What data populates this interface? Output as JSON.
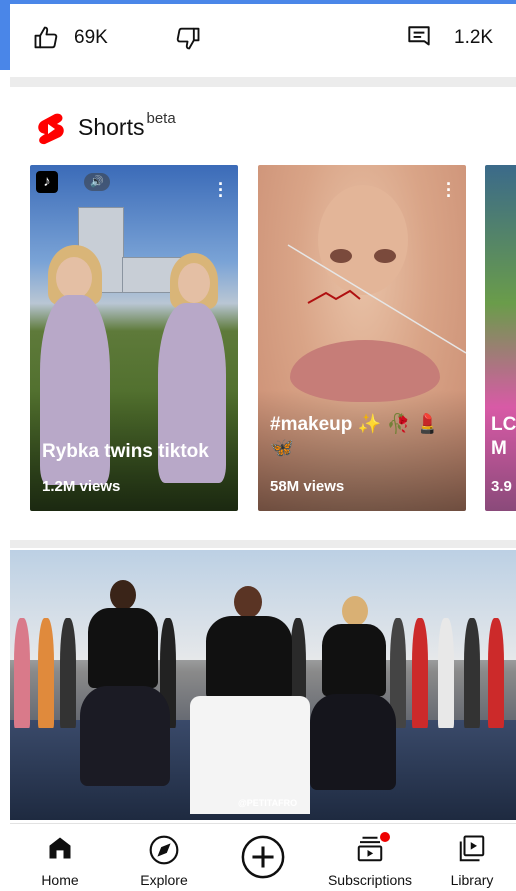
{
  "actions": {
    "like_count": "69K",
    "comment_count": "1.2K"
  },
  "shorts": {
    "title": "Shorts",
    "badge": "beta",
    "items": [
      {
        "title": "Rybka twins tiktok",
        "views": "1.2M views"
      },
      {
        "title": "#makeup ✨ 🥀 💄 🦋",
        "views": "58M views"
      },
      {
        "title": "LC M",
        "views": "3.9"
      }
    ]
  },
  "video": {
    "watermark": "@PETITAFRO"
  },
  "nav": {
    "home": "Home",
    "explore": "Explore",
    "subscriptions": "Subscriptions",
    "library": "Library"
  },
  "colors": {
    "accent_blue": "#4a86e8",
    "shorts_red": "#ff0000",
    "notification_red": "#e00000"
  },
  "icons": [
    "thumb-up-icon",
    "thumb-down-icon",
    "comment-icon",
    "shorts-logo-icon",
    "home-icon",
    "explore-icon",
    "create-icon",
    "subscriptions-icon",
    "library-icon"
  ]
}
